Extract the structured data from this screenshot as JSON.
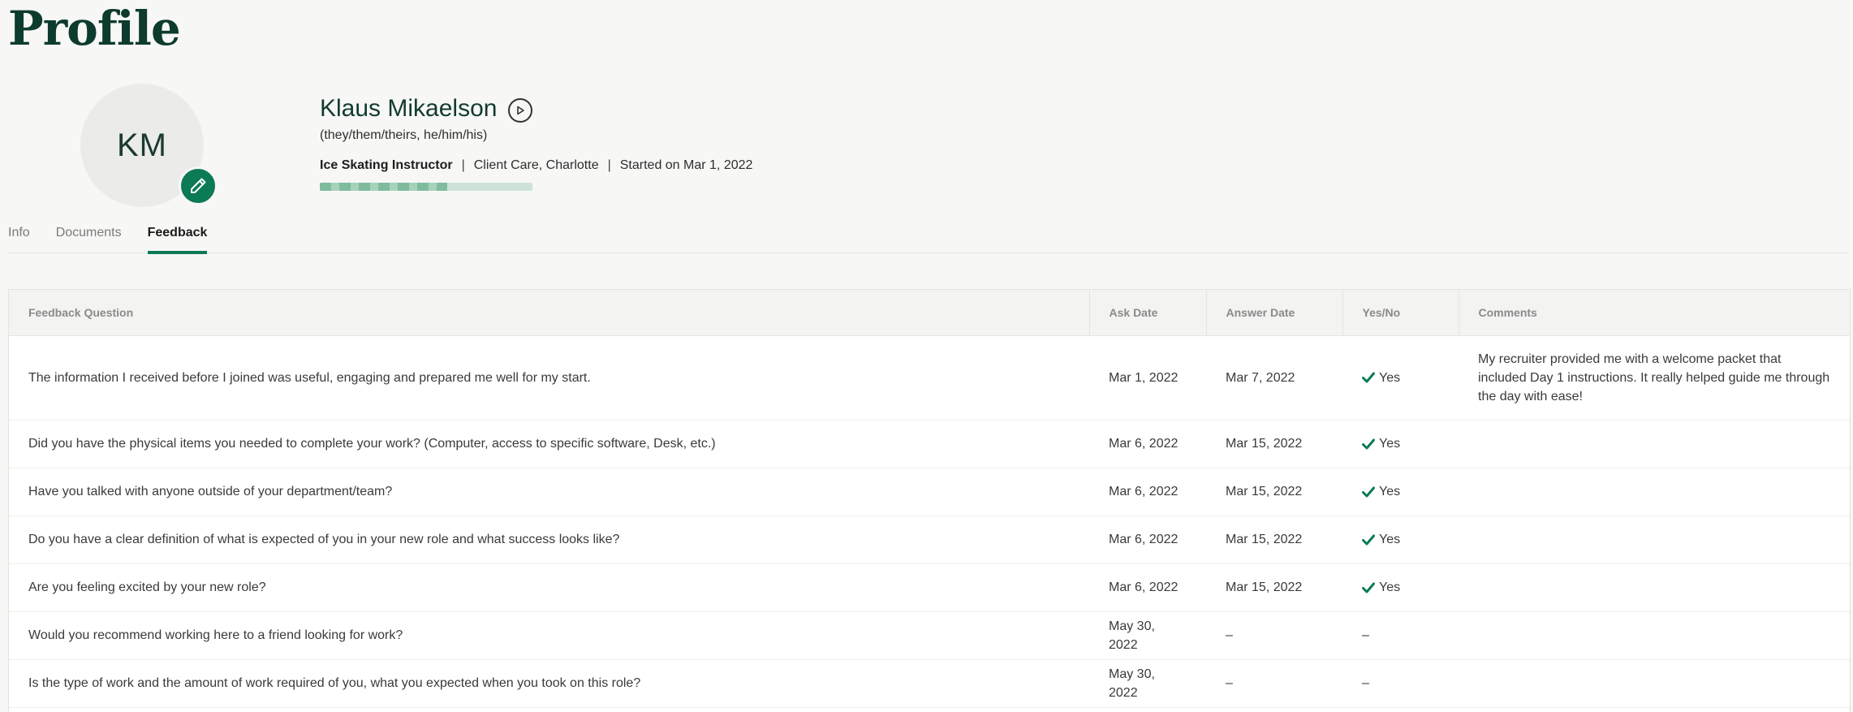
{
  "page": {
    "title": "Profile"
  },
  "profile": {
    "initials": "KM",
    "name": "Klaus Mikaelson",
    "pronouns": "(they/them/theirs, he/him/his)",
    "job_title": "Ice Skating Instructor",
    "department": "Client Care, Charlotte",
    "start": "Started on Mar 1, 2022",
    "onboarding_progress": 0.6,
    "accent_color": "#0b7a55"
  },
  "tabs": [
    {
      "label": "Info",
      "active": false
    },
    {
      "label": "Documents",
      "active": false
    },
    {
      "label": "Feedback",
      "active": true
    }
  ],
  "table": {
    "headers": {
      "question": "Feedback Question",
      "ask_date": "Ask Date",
      "answer_date": "Answer Date",
      "yes_no": "Yes/No",
      "comments": "Comments"
    },
    "rows": [
      {
        "question": "The information I received before I joined was useful, engaging and prepared me well for my start.",
        "ask_date": "Mar 1, 2022",
        "answer_date": "Mar 7, 2022",
        "answer": "Yes",
        "comments": "My recruiter provided me with a welcome packet that included Day 1 instructions. It really helped guide me through the day with ease!"
      },
      {
        "question": "Did you have the physical items you needed to complete your work? (Computer, access to specific software, Desk, etc.)",
        "ask_date": "Mar 6, 2022",
        "answer_date": "Mar 15, 2022",
        "answer": "Yes",
        "comments": ""
      },
      {
        "question": "Have you talked with anyone outside of your department/team?",
        "ask_date": "Mar 6, 2022",
        "answer_date": "Mar 15, 2022",
        "answer": "Yes",
        "comments": ""
      },
      {
        "question": "Do you have a clear definition of what is expected of you in your new role and what success looks like?",
        "ask_date": "Mar 6, 2022",
        "answer_date": "Mar 15, 2022",
        "answer": "Yes",
        "comments": ""
      },
      {
        "question": "Are you feeling excited by your new role?",
        "ask_date": "Mar 6, 2022",
        "answer_date": "Mar 15, 2022",
        "answer": "Yes",
        "comments": ""
      },
      {
        "question": "Would you recommend working here to a friend looking for work?",
        "ask_date": "May 30, 2022",
        "answer_date": "–",
        "answer": "–",
        "comments": ""
      },
      {
        "question": "Is the type of work and the amount of work required of you, what you expected when you took on this role?",
        "ask_date": "May 30, 2022",
        "answer_date": "–",
        "answer": "–",
        "comments": ""
      }
    ]
  }
}
